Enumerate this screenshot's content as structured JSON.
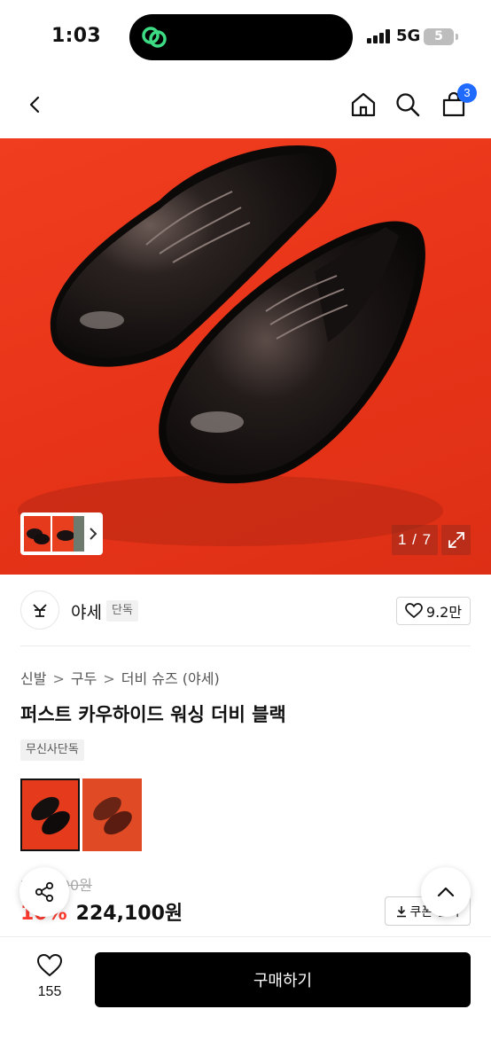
{
  "status_bar": {
    "time": "1:03",
    "network": "5G",
    "battery": "5"
  },
  "nav": {
    "cart_count": "3"
  },
  "gallery": {
    "counter": "1 / 7"
  },
  "brand": {
    "logo_text": "YA",
    "name": "야세",
    "tag": "단독",
    "likes": "9.2만"
  },
  "breadcrumb": [
    "신발",
    "구두",
    "더비 슈즈 (야세)"
  ],
  "product": {
    "title": "퍼스트 카우하이드 워싱 더비 블랙",
    "badge": "무신사단독",
    "original_price": "249,000원",
    "discount": "10%",
    "price": "224,100원",
    "coupon_label": "쿠폰 받기"
  },
  "bottom_bar": {
    "wish_count": "155",
    "buy_label": "구매하기"
  },
  "colors": {
    "hero_red": "#e93519",
    "accent_blue": "#1f6bff",
    "discount_red": "#ff3b30"
  }
}
